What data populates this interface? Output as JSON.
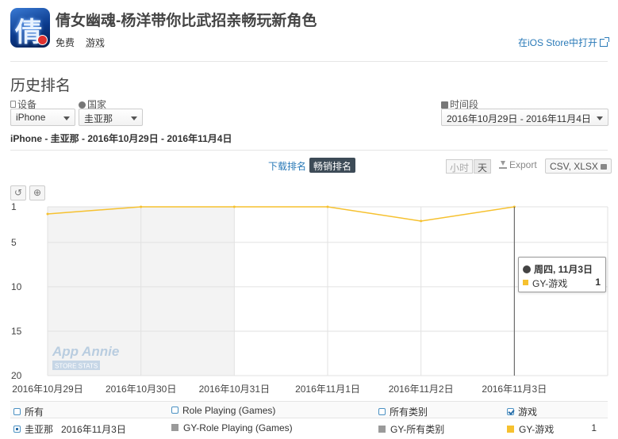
{
  "app": {
    "icon_glyph": "倩",
    "title": "倩女幽魂-杨洋带你比武招亲畅玩新角色",
    "price": "免费",
    "category": "游戏",
    "open_store": "在iOS Store中打开"
  },
  "section_title": "历史排名",
  "filters": {
    "device_label": "设备",
    "device_value": "iPhone",
    "country_label": "国家",
    "country_value": "圭亚那",
    "period_label": "时间段",
    "period_value": "2016年10月29日 - 2016年11月4日"
  },
  "subtitle": "iPhone - 圭亚那 - 2016年10月29日 - 2016年11月4日",
  "tabs": {
    "downloads": "下载排名",
    "grossing": "畅销排名"
  },
  "toolbar": {
    "hour": "小时",
    "day": "天",
    "export": "Export",
    "csv": "CSV, XLSX",
    "reset_icon": "↺",
    "zoom_icon": "⊕"
  },
  "colors": {
    "series": "#f6c12f",
    "gray_series": "#9a9a9a",
    "accent": "#2a7ab8"
  },
  "watermark": {
    "line1": "App Annie",
    "line2": "STORE STATS"
  },
  "tooltip": {
    "date": "周四, 11月3日",
    "series": "GY-游戏",
    "value": "1"
  },
  "legend": {
    "row1": [
      "所有",
      "Role Playing (Games)",
      "所有类别",
      "游戏"
    ],
    "country": "圭亚那",
    "date": "2016年11月3日",
    "series": [
      "GY-Role Playing (Games)",
      "GY-所有类别",
      "GY-游戏"
    ],
    "value": "1"
  },
  "chart_data": {
    "type": "line",
    "x": [
      "2016年10月29日",
      "2016年10月30日",
      "2016年10月31日",
      "2016年11月1日",
      "2016年11月2日",
      "2016年11月3日"
    ],
    "series": [
      {
        "name": "GY-游戏",
        "values": [
          1.8,
          1,
          1,
          1,
          2.6,
          1
        ]
      }
    ],
    "y_ticks": [
      "1",
      "5",
      "10",
      "15",
      "20"
    ],
    "ylim": [
      1,
      20
    ],
    "y_inverted": true,
    "grid": true,
    "highlight_x": "2016年11月3日"
  }
}
